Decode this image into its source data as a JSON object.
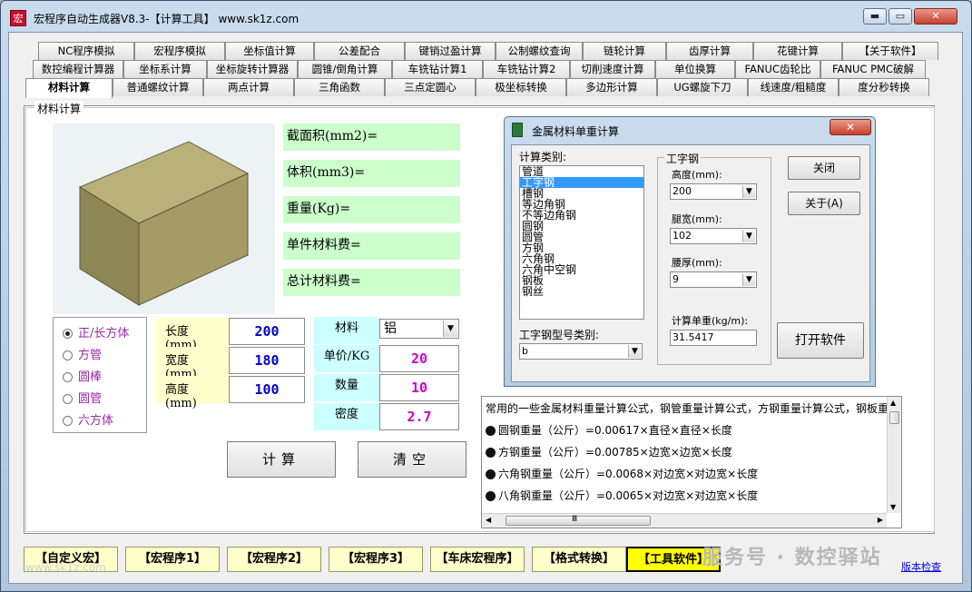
{
  "window": {
    "title": "宏程序自动生成器V8.3-【计算工具】    www.sk1z.com",
    "icon_text": "宏",
    "min_label": "▬",
    "max_label": "▭",
    "close_label": "✕"
  },
  "tabs": {
    "row1": [
      "NC程序模拟",
      "宏程序模拟",
      "坐标值计算",
      "公差配合",
      "键销过盈计算",
      "公制螺纹查询",
      "链轮计算",
      "齿厚计算",
      "花键计算",
      "【关于软件】"
    ],
    "row2": [
      "数控编程计算器",
      "坐标系计算",
      "坐标旋转计算器",
      "圆锥/倒角计算",
      "车铣钻计算1",
      "车铣钻计算2",
      "切削速度计算",
      "单位换算",
      "FANUC齿轮比",
      "FANUC PMC破解"
    ],
    "row3": [
      "材料计算",
      "普通螺纹计算",
      "两点计算",
      "三角函数",
      "三点定圆心",
      "极坐标转换",
      "多边形计算",
      "UG螺旋下刀",
      "线速度/粗糙度",
      "度分秒转换"
    ]
  },
  "material": {
    "group_title": "材料计算",
    "results": [
      "截面积(mm2)=",
      "体积(mm3)=",
      "重量(Kg)=",
      "单件材料费=",
      "总计材料费="
    ],
    "shapes": [
      "正/长方体",
      "方管",
      "圆棒",
      "圆管",
      "六方体"
    ],
    "selected_shape": 0,
    "dims": [
      {
        "label": "长度(mm)",
        "value": "200"
      },
      {
        "label": "宽度(mm)",
        "value": "180"
      },
      {
        "label": "高度(mm)",
        "value": "100"
      }
    ],
    "material_label": "材料",
    "material_value": "铝",
    "props": [
      {
        "label": "单价/KG",
        "value": "20"
      },
      {
        "label": "数量",
        "value": "10"
      },
      {
        "label": "密度",
        "value": "2.7"
      }
    ],
    "calc_btn": "计算",
    "clear_btn": "清空"
  },
  "dialog": {
    "title": "金属材料单重计算",
    "close_label": "✕",
    "calc_type_label": "计算类别:",
    "types": [
      "管道",
      "工字钢",
      "槽钢",
      "等边角钢",
      "不等边角钢",
      "圆钢",
      "圆管",
      "方钢",
      "六角钢",
      "六角中空钢",
      "钢板",
      "钢丝"
    ],
    "selected_type": 1,
    "model_label": "工字钢型号类别:",
    "model_value": "b",
    "group_title": "工字钢",
    "height_label": "高度(mm):",
    "height_value": "200",
    "leg_label": "腿宽(mm):",
    "leg_value": "102",
    "waist_label": "腰厚(mm):",
    "waist_value": "9",
    "unit_weight_label": "计算单重(kg/m):",
    "unit_weight_value": "31.5417",
    "close_btn": "关闭",
    "about_btn": "关于(A)",
    "open_btn": "打开软件"
  },
  "formulas": {
    "header": "常用的一些金属材料重量计算公式，钢管重量计算公式，方钢重量计算公式，钢板重",
    "lines": [
      "圆钢重量（公斤）=0.00617×直径×直径×长度",
      "方钢重量（公斤）=0.00785×边宽×边宽×长度",
      "六角钢重量（公斤）=0.0068×对边宽×对边宽×长度",
      "八角钢重量（公斤）=0.0065×对边宽×对边宽×长度"
    ],
    "scroll_thumb": "Ⅲ"
  },
  "bottom": {
    "buttons": [
      "【自定义宏】",
      "【宏程序1】",
      "【宏程序2】",
      "【宏程序3】",
      "【车床宏程序】",
      "【格式转换】",
      "【工具软件】"
    ],
    "active": 6,
    "watermark": "服务号 · 数控驿站",
    "watermark_url": "www.sk1z.com",
    "version_link": "版本检查"
  },
  "colors": {
    "result_bg": "#ccffcc",
    "dim_label_bg": "#ffffcc",
    "mat_label_bg": "#ccffff",
    "radio_text": "#9b28a8",
    "dim_value": "#0000cc",
    "mat_value": "#cc00cc"
  }
}
